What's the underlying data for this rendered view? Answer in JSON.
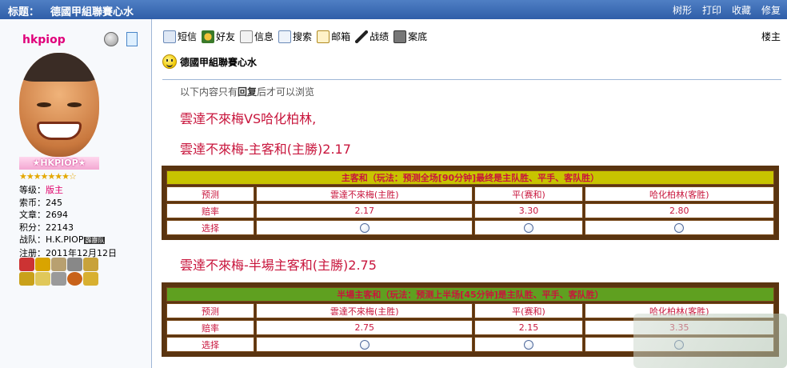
{
  "header": {
    "title_label": "标题：",
    "title": "德國甲組聯賽心水",
    "actions": [
      "树形",
      "打印",
      "收藏",
      "修复"
    ]
  },
  "profile": {
    "username": "hkpiop",
    "rank_banner": "HKPIOP",
    "stars": "★★★★★★★☆",
    "stats": [
      {
        "key": "等级：",
        "value": "版主"
      },
      {
        "key": "索币：",
        "value": "245"
      },
      {
        "key": "文章：",
        "value": "2694"
      },
      {
        "key": "积分：",
        "value": "22143"
      },
      {
        "key": "战队：",
        "value": "H.K.PIOP"
      },
      {
        "key": "注册：",
        "value": "2011年12月12日"
      }
    ],
    "team_badge": "霹靂队"
  },
  "toolbar": {
    "items": [
      "短信",
      "好友",
      "信息",
      "搜索",
      "邮箱",
      "战绩",
      "案底"
    ],
    "floor": "楼主"
  },
  "post": {
    "title": "德國甲組聯賽心水",
    "notice_pre": "以下内容只有",
    "notice_bold": "回复",
    "notice_post": "后才可以浏览",
    "line1": "雲達不來梅VS哈化柏林,",
    "line2": "雲達不來梅-主客和(主勝)2.17",
    "line3": "雲達不來梅-半場主客和(主勝)2.75"
  },
  "table1": {
    "header": "主客和（玩法：预测全场[90分钟]最终是主队胜、平手、客队胜）",
    "row_labels": [
      "预测",
      "赔率",
      "选择"
    ],
    "options": [
      "雲達不來梅(主胜)",
      "平(赛和)",
      "哈化柏林(客胜)"
    ],
    "odds": [
      "2.17",
      "3.30",
      "2.80"
    ]
  },
  "table2": {
    "header": "半場主客和（玩法：预测上半场[45分钟]是主队胜、平手、客队胜）",
    "row_labels": [
      "预测",
      "赔率",
      "选择"
    ],
    "options": [
      "雲達不來梅(主胜)",
      "平(赛和)",
      "哈化柏林(客胜)"
    ],
    "odds": [
      "2.75",
      "2.15",
      "3.35"
    ]
  },
  "colors": {
    "header_bar": "#3a6cb8",
    "accent_red": "#c8153c",
    "table1_header": "#c8c400",
    "table2_header": "#5fa020",
    "table_border": "#5a3410"
  }
}
